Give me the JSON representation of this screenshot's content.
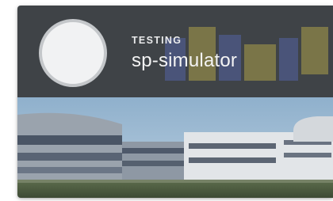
{
  "card": {
    "eyebrow": "TESTING",
    "title": "sp-simulator"
  },
  "icons": {
    "avatar": "avatar-placeholder",
    "watermark": "logo-watermark"
  },
  "colors": {
    "header_bg": "#3f4347",
    "avatar_fill": "#f1f2f3",
    "avatar_ring": "#c4c7ca",
    "watermark_blue": "#5b6fbf",
    "watermark_yellow": "#cdbc4a"
  },
  "image": {
    "subject": "photo-of-office-buildings"
  }
}
